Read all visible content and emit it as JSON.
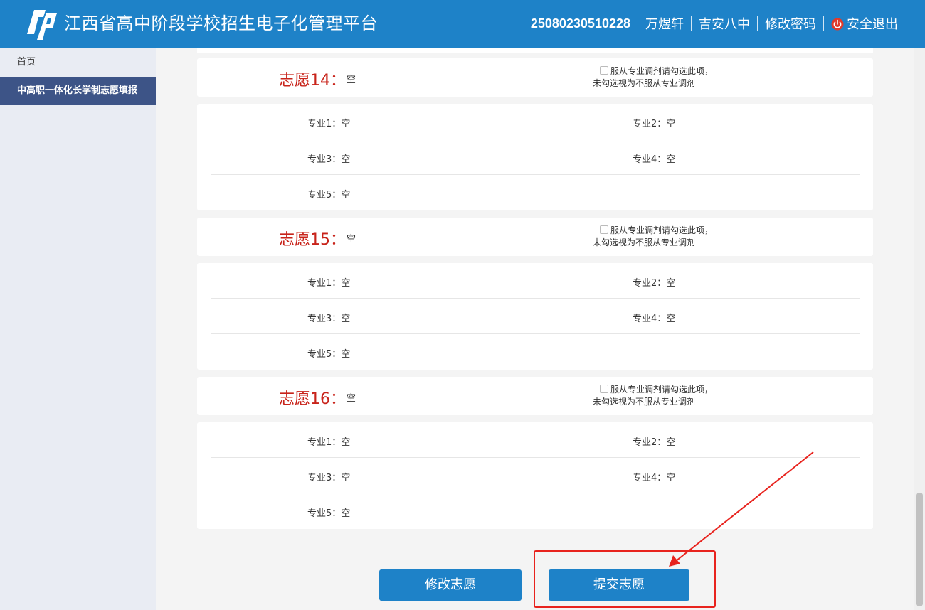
{
  "header": {
    "title": "江西省高中阶段学校招生电子化管理平台",
    "user_id": "25080230510228",
    "user_name": "万煜轩",
    "school": "吉安八中",
    "change_password": "修改密码",
    "logout": "安全退出"
  },
  "sidebar": {
    "items": [
      {
        "label": "首页"
      },
      {
        "label": "中高职一体化长学制志愿填报"
      }
    ]
  },
  "adjust_text": {
    "line1": "服从专业调剂请勾选此项，",
    "line2": "未勾选视为不服从专业调剂"
  },
  "wishes": [
    {
      "label": "志愿14：",
      "value": "空",
      "majors": [
        {
          "label": "专业1：",
          "value": "空"
        },
        {
          "label": "专业2：",
          "value": "空"
        },
        {
          "label": "专业3：",
          "value": "空"
        },
        {
          "label": "专业4：",
          "value": "空"
        },
        {
          "label": "专业5：",
          "value": "空"
        }
      ]
    },
    {
      "label": "志愿15：",
      "value": "空",
      "majors": [
        {
          "label": "专业1：",
          "value": "空"
        },
        {
          "label": "专业2：",
          "value": "空"
        },
        {
          "label": "专业3：",
          "value": "空"
        },
        {
          "label": "专业4：",
          "value": "空"
        },
        {
          "label": "专业5：",
          "value": "空"
        }
      ]
    },
    {
      "label": "志愿16：",
      "value": "空",
      "majors": [
        {
          "label": "专业1：",
          "value": "空"
        },
        {
          "label": "专业2：",
          "value": "空"
        },
        {
          "label": "专业3：",
          "value": "空"
        },
        {
          "label": "专业4：",
          "value": "空"
        },
        {
          "label": "专业5：",
          "value": "空"
        }
      ]
    }
  ],
  "buttons": {
    "modify": "修改志愿",
    "submit": "提交志愿"
  },
  "colors": {
    "header_bg": "#1e82c8",
    "wish_label": "#c8231a",
    "sidebar_active": "#3d5487",
    "annotation": "#e8231e"
  }
}
